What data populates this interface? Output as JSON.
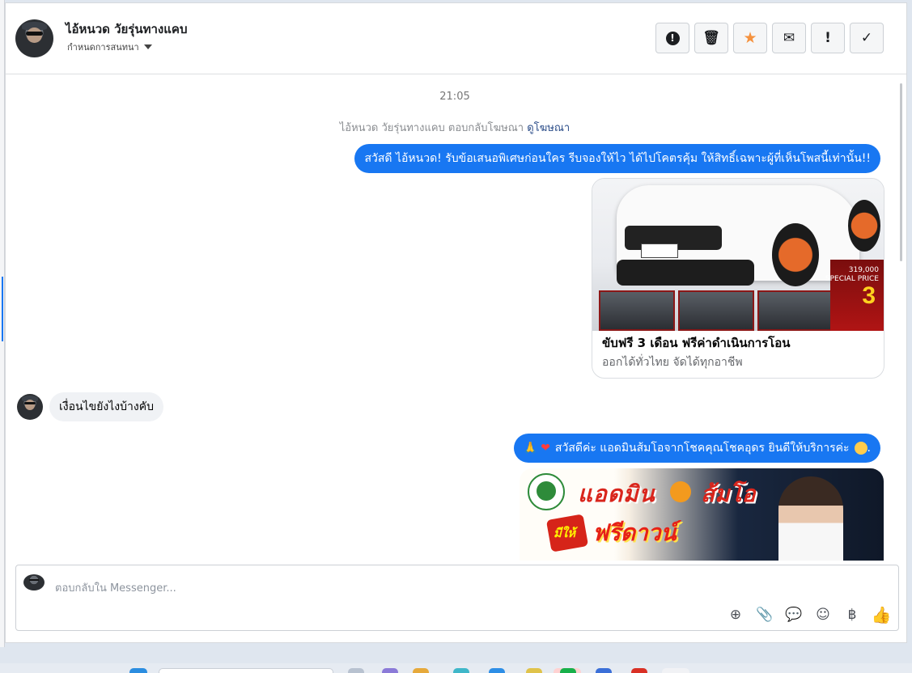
{
  "header": {
    "name": "ไอ้หนวด วัยรุ่นทางแคบ",
    "subtitle": "กำหนดการสนทนา",
    "toolbar": [
      {
        "icon": "alert-circle-icon",
        "glyph": "!"
      },
      {
        "icon": "trash-icon",
        "glyph": "🗑"
      },
      {
        "icon": "star-icon",
        "glyph": "★"
      },
      {
        "icon": "envelope-icon",
        "glyph": "✉"
      },
      {
        "icon": "exclamation-icon",
        "glyph": "!"
      },
      {
        "icon": "check-icon",
        "glyph": "✓"
      }
    ]
  },
  "conversation": {
    "timestamp": "21:05",
    "ad_reply_text": "ไอ้หนวด วัยรุ่นทางแคบ ตอบกลับโฆษณา",
    "ad_link": "ดูโฆษณา",
    "messages": {
      "greeting": "สวัสดี ไอ้หนวด! รับข้อเสนอพิเศษก่อนใคร รีบจองให้ไว ได้ไปโคตรคุ้ม ให้สิทธิ์เฉพาะผู้ที่เห็นโพสนี้เท่านั้น!!",
      "card_title": "ขับฟรี 3 เดือน ฟรีค่าดำเนินการโอน",
      "card_subtitle": "ออกได้ทั่วไทย จัดได้ทุกอาชีพ",
      "card_image_price": "319,000",
      "card_image_special": "SPECIAL PRICE",
      "card_image_promo_num": "3",
      "incoming": "เงื่อนไขยังไงบ้างคับ",
      "reply_hands": "🙏",
      "reply_heart": "❤",
      "reply_text": "สวัสดีค่ะ แอดมินส้มโอจากโชคคุณโชคอุดร ยินดีให้บริการค่ะ",
      "reply_trailing": ".",
      "promo_title_a": "แอดมิน",
      "promo_title_b": "ส้มโอ",
      "promo_burst": "มีให้",
      "promo_free": "ฟรีดาวน์"
    }
  },
  "composer": {
    "placeholder": "ตอบกลับใน Messenger...",
    "icons": [
      {
        "name": "sticker-icon",
        "glyph": "⊕"
      },
      {
        "name": "attachment-icon",
        "glyph": "📎"
      },
      {
        "name": "chat-bubble-icon",
        "glyph": "💬"
      },
      {
        "name": "emoji-icon",
        "glyph": "☺"
      },
      {
        "name": "baht-icon",
        "glyph": "฿"
      },
      {
        "name": "like-icon",
        "glyph": "👍"
      }
    ]
  },
  "colors": {
    "accent": "#1877f2",
    "star": "#f5923e"
  }
}
